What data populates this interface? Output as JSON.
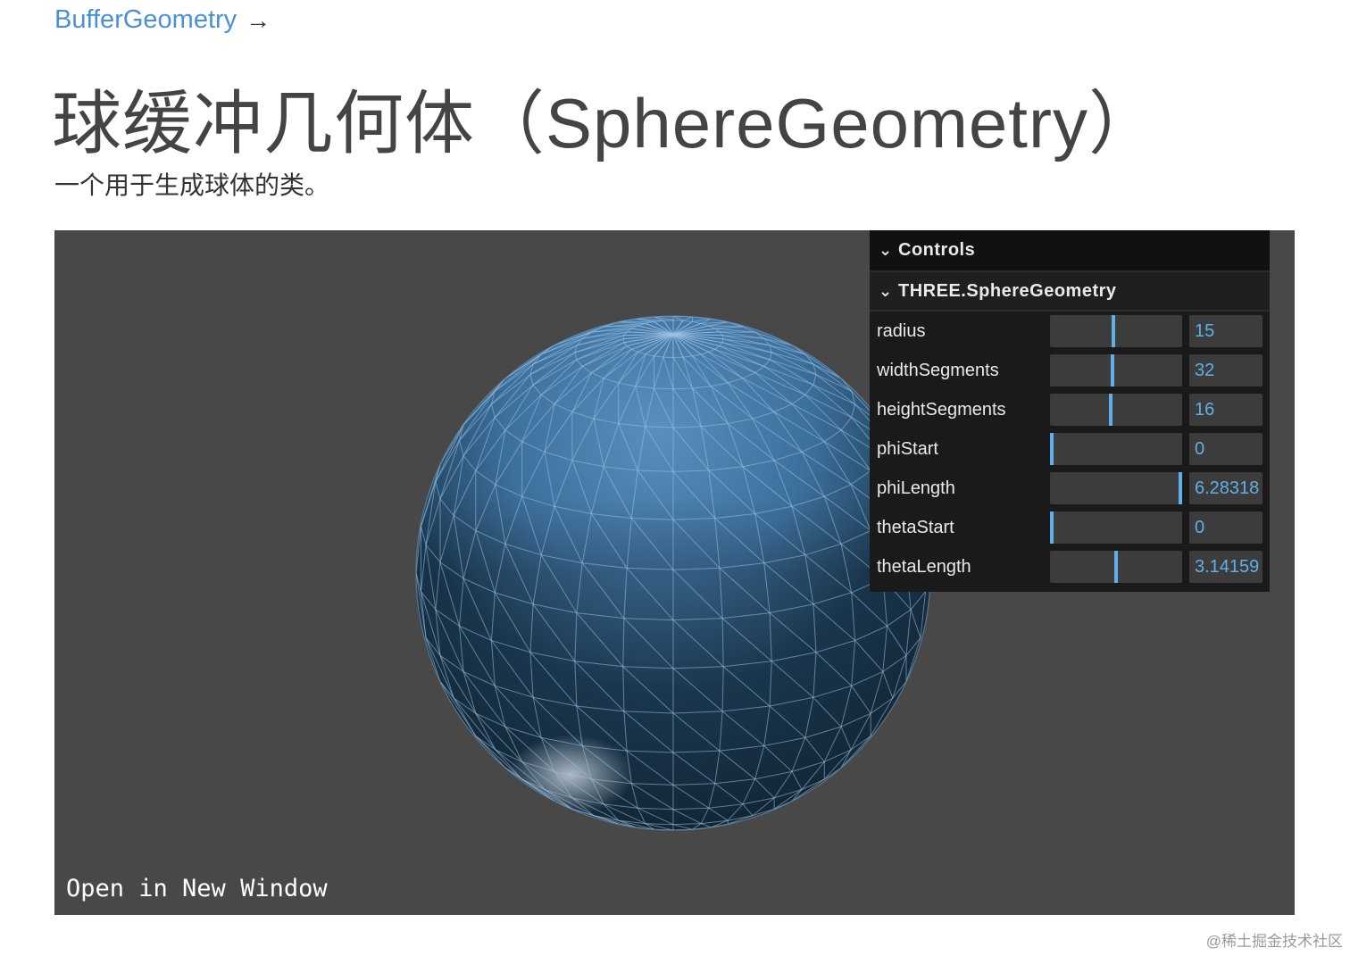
{
  "breadcrumb": {
    "link": "BufferGeometry",
    "arrow": "→"
  },
  "page": {
    "title": "球缓冲几何体（SphereGeometry）",
    "description": "一个用于生成球体的类。"
  },
  "viewport": {
    "open_link": "Open in New Window"
  },
  "gui": {
    "header": "Controls",
    "folder": "THREE.SphereGeometry",
    "rows": [
      {
        "label": "radius",
        "value": "15",
        "fill": 0.48
      },
      {
        "label": "widthSegments",
        "value": "32",
        "fill": 0.47
      },
      {
        "label": "heightSegments",
        "value": "16",
        "fill": 0.46
      },
      {
        "label": "phiStart",
        "value": "0",
        "fill": 0.0
      },
      {
        "label": "phiLength",
        "value": "6.28318",
        "fill": 1.0
      },
      {
        "label": "thetaStart",
        "value": "0",
        "fill": 0.0
      },
      {
        "label": "thetaLength",
        "value": "3.14159",
        "fill": 0.5
      }
    ]
  },
  "watermark": "@稀土掘金技术社区",
  "colors": {
    "accent": "#5fb0e8",
    "link": "#4a90d9",
    "viewport_bg": "#484848",
    "sphere_light": "#4a7fae",
    "sphere_dark": "#142a3c"
  }
}
